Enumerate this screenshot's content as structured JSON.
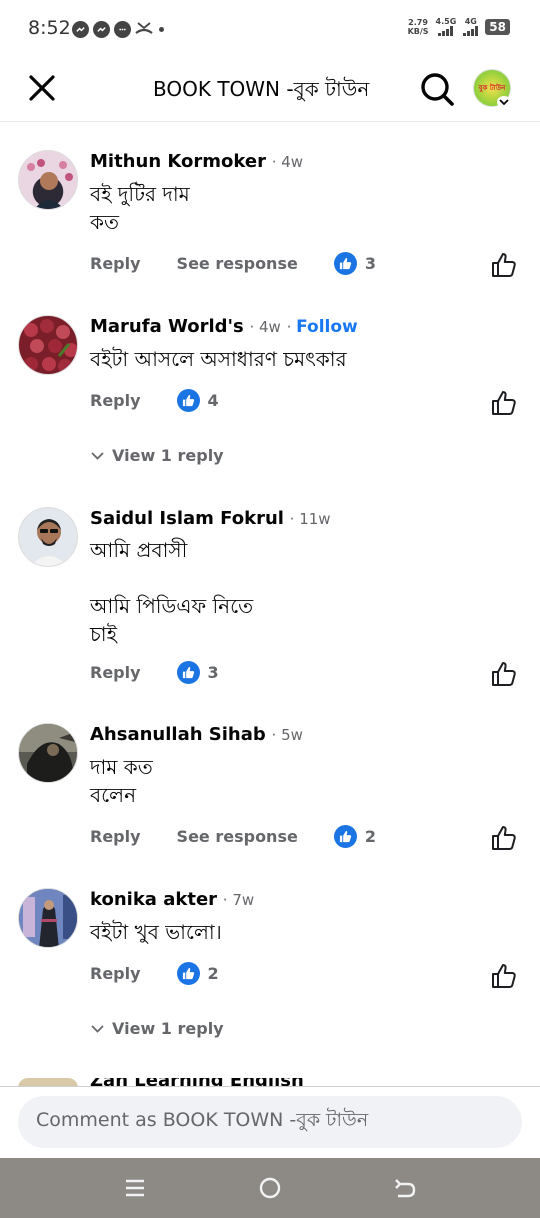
{
  "status_bar": {
    "time": "8:52",
    "net_speed_value": "2.79",
    "net_speed_unit": "KB/S",
    "sim1_label": "4.5G",
    "sim2_label": "4G",
    "battery": "58"
  },
  "header": {
    "title": "BOOK TOWN -বুক টাউন",
    "avatar_label": "বুক টাউন"
  },
  "comments": [
    {
      "name": "Mithun Kormoker",
      "time": "4w",
      "text": "বই দুটির দাম\nকত",
      "reply_label": "Reply",
      "see_response_label": "See response",
      "reactions": "3"
    },
    {
      "name": "Marufa World's",
      "time": "4w",
      "follow_label": "Follow",
      "text": "বইটা আসলে অসাধারণ চমৎকার",
      "reply_label": "Reply",
      "reactions": "4",
      "view_replies": "View 1 reply"
    },
    {
      "name": "Saidul Islam Fokrul",
      "time": "11w",
      "text": "আমি প্রবাসী\n\nআমি পিডিএফ নিতে\nচাই",
      "reply_label": "Reply",
      "reactions": "3"
    },
    {
      "name": "Ahsanullah Sihab",
      "time": "5w",
      "text": "দাম কত\nবলেন",
      "reply_label": "Reply",
      "see_response_label": "See response",
      "reactions": "2"
    },
    {
      "name": "konika akter",
      "time": "7w",
      "text": "বইটা খুব ভালো।",
      "reply_label": "Reply",
      "reactions": "2",
      "view_replies": "View 1 reply"
    }
  ],
  "partial_comment_name": "Zan Learning English",
  "composer": {
    "placeholder": "Comment as BOOK TOWN -বুক টাউন"
  },
  "colors": {
    "accent": "#1877f2",
    "like_badge": "#1b74e4",
    "secondary_text": "#65676b",
    "composer_bg": "#f0f2f5",
    "nav_bar": "#8d8a86"
  }
}
